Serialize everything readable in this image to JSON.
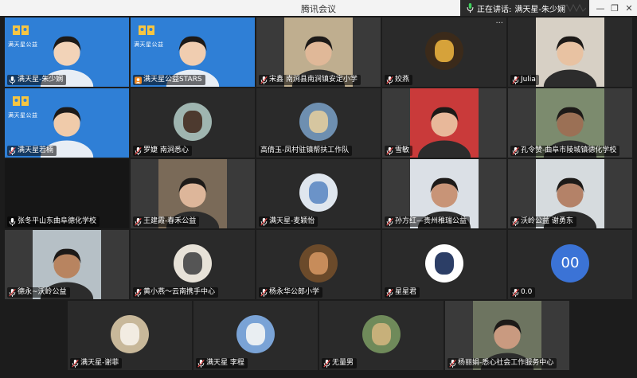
{
  "window": {
    "title": "腾讯会议",
    "speaking_label": "正在讲话:",
    "speaking_name": "满天星-朱少娴"
  },
  "logo_text": "满天星公益",
  "colors": {
    "accent_active": "#24c24a",
    "brand_blue": "#2f7fd6",
    "avatar_blue": "#3b73d6",
    "host_orange": "#f08a24"
  },
  "participants": [
    {
      "name": "满天星-朱少娴",
      "icon": "mic-icon",
      "video": true,
      "active": true
    },
    {
      "name": "满天星公益STARS",
      "icon": "host-icon",
      "video": true
    },
    {
      "name": "宋鑫   南涧县南涧镇安定小学",
      "icon": "mic-muted-icon",
      "video": true
    },
    {
      "name": "姣燕",
      "icon": "mic-muted-icon",
      "video": false
    },
    {
      "name": "Julia",
      "icon": "mic-muted-icon",
      "video": true
    },
    {
      "name": "满天星若楠",
      "icon": "mic-muted-icon",
      "video": true
    },
    {
      "name": "罗婕 南涧悉心",
      "icon": "mic-muted-icon",
      "video": false
    },
    {
      "name": "高倩玉-凤村驻镇帮扶工作队",
      "icon": "none",
      "video": false
    },
    {
      "name": "雪敏",
      "icon": "mic-muted-icon",
      "video": true
    },
    {
      "name": "孔令赞-曲阜市陵城镇德化学校",
      "icon": "mic-muted-icon",
      "video": true
    },
    {
      "name": "张冬平山东曲阜德化学校",
      "icon": "mic-icon",
      "video": false
    },
    {
      "name": "王建霞-春禾公益",
      "icon": "mic-muted-icon",
      "video": true
    },
    {
      "name": "满天星-麦颖怡",
      "icon": "mic-muted-icon",
      "video": false
    },
    {
      "name": "孙方红—贵州稚瑞公益",
      "icon": "mic-muted-icon",
      "video": true
    },
    {
      "name": "沃岭公益   谢勇东",
      "icon": "mic-muted-icon",
      "video": true
    },
    {
      "name": "德永~沃岭公益",
      "icon": "mic-muted-icon",
      "video": true
    },
    {
      "name": "黄小燕～云南携手中心",
      "icon": "mic-muted-icon",
      "video": false
    },
    {
      "name": "杨永华公郎小学",
      "icon": "mic-muted-icon",
      "video": false
    },
    {
      "name": "星星君",
      "icon": "mic-muted-icon",
      "video": false
    },
    {
      "name": "0.0",
      "icon": "mic-muted-icon",
      "video": false,
      "initials": "00"
    },
    {
      "name": "满天星-谢菲",
      "icon": "mic-muted-icon",
      "video": false
    },
    {
      "name": "满天星   李程",
      "icon": "mic-muted-icon",
      "video": false
    },
    {
      "name": "无量男",
      "icon": "mic-muted-icon",
      "video": false
    },
    {
      "name": "杨丽娟-悉心社会工作服务中心",
      "icon": "mic-muted-icon",
      "video": true
    }
  ]
}
